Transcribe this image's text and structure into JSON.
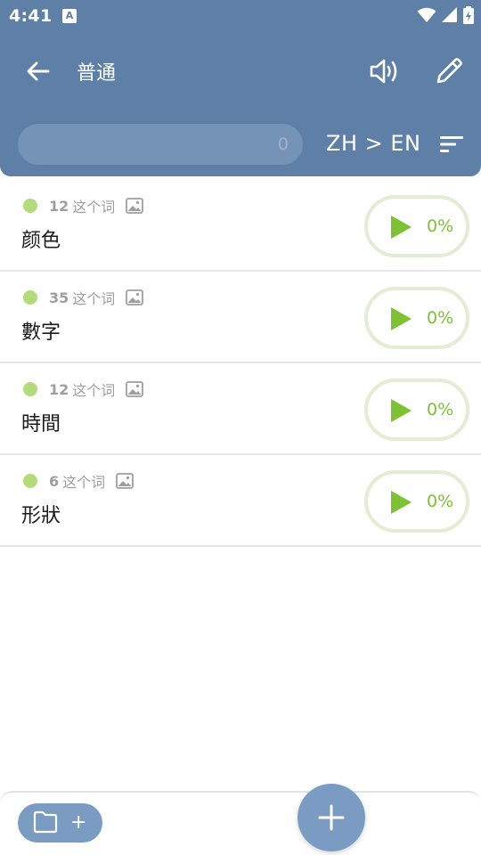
{
  "status_bar": {
    "time": "4:41",
    "notification_letter": "A"
  },
  "toolbar": {
    "title": "普通",
    "back_icon": "arrow-left-icon",
    "speaker_icon": "speaker-icon",
    "edit_icon": "pencil-icon"
  },
  "search": {
    "count": "0"
  },
  "language_pair": "ZH > EN",
  "sort_icon": "sort-icon",
  "lists": [
    {
      "count": "12",
      "unit": "这个词",
      "title": "颜色",
      "progress": "0%",
      "progress_value": 0
    },
    {
      "count": "35",
      "unit": "这个词",
      "title": "數字",
      "progress": "0%",
      "progress_value": 0
    },
    {
      "count": "12",
      "unit": "这个词",
      "title": "時間",
      "progress": "0%",
      "progress_value": 0
    },
    {
      "count": "6",
      "unit": "这个词",
      "title": "形狀",
      "progress": "0%",
      "progress_value": 0
    }
  ],
  "bottom": {
    "folder_add_label": "+",
    "fab_icon": "plus-icon"
  },
  "colors": {
    "header": "#5e7fa6",
    "accent": "#7a9bc2",
    "dot": "#b2dc7a",
    "progress_text": "#7cc233",
    "play": "#7cc233"
  }
}
